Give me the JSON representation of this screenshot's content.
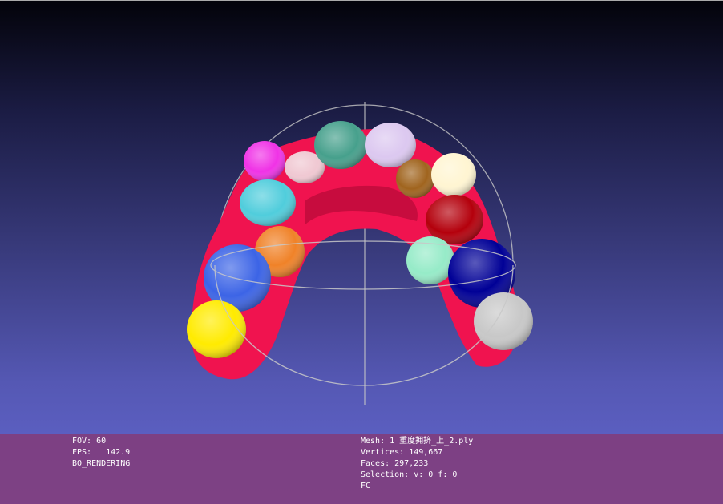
{
  "colors": {
    "gum": "#f0134f",
    "trackball": "#c8c8c8",
    "teeth": {
      "magenta": "#f032e6",
      "pale_pink": "#f0c8d2",
      "teal": "#46a08c",
      "lavender": "#dcc8f0",
      "brown": "#a0641e",
      "cream": "#fff5d2",
      "cyan": "#50cddc",
      "dark_red": "#b4000c",
      "orange": "#f08228",
      "mint": "#96ebc8",
      "blue": "#3c64e6",
      "navy": "#000096",
      "yellow": "#ffeb00",
      "light_gray": "#c8c8c8"
    }
  },
  "info": {
    "fov_label": "FOV:",
    "fov_value": "60",
    "fps_label": "FPS:",
    "fps_value": "142.9",
    "render_mode": "BO_RENDERING",
    "mesh_label": "Mesh:",
    "mesh_value": "1 重度拥挤_上_2.ply",
    "vertices_label": "Vertices:",
    "vertices_value": "149,667",
    "faces_label": "Faces:",
    "faces_value": "297,233",
    "selection_label": "Selection:",
    "selection_value": "v: 0 f: 0",
    "shading_mode": "FC"
  }
}
